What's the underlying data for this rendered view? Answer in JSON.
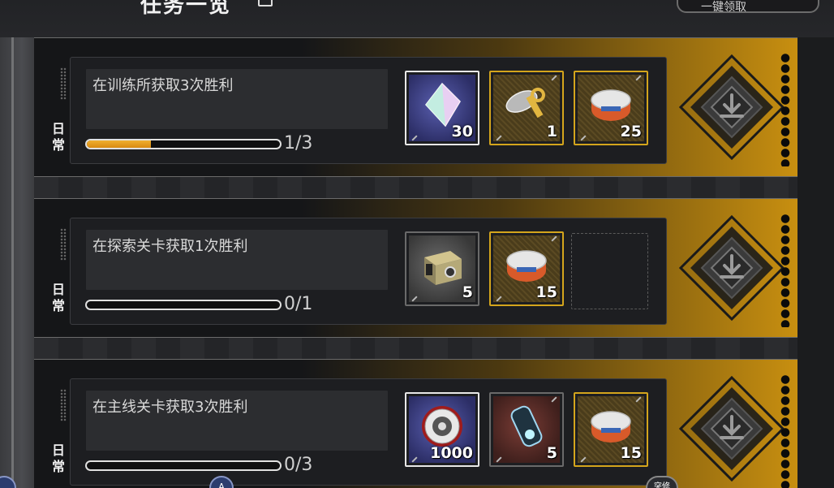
{
  "header": {
    "title": "任务一览",
    "right_button_label": "一键领取"
  },
  "tasks": [
    {
      "category": "日常",
      "description": "在训练所获取3次胜利",
      "progress_text": "1/3",
      "progress_fraction": 0.333,
      "rewards": [
        {
          "icon": "crystal-shard-icon",
          "count": "30",
          "frame": "silver",
          "bg": "purple"
        },
        {
          "icon": "key-and-tag-icon",
          "count": "1",
          "frame": "gold",
          "bg": "gold"
        },
        {
          "icon": "cat-food-can-icon",
          "count": "25",
          "frame": "gold",
          "bg": "gold"
        }
      ]
    },
    {
      "category": "日常",
      "description": "在探索关卡获取1次胜利",
      "progress_text": "0/1",
      "progress_fraction": 0.0,
      "rewards": [
        {
          "icon": "supply-box-icon",
          "count": "5",
          "frame": "grey",
          "bg": "greybg"
        },
        {
          "icon": "cat-food-can-icon",
          "count": "15",
          "frame": "gold",
          "bg": "gold"
        },
        {
          "icon": "empty-slot",
          "count": "",
          "frame": "empty",
          "bg": ""
        }
      ]
    },
    {
      "category": "日常",
      "description": "在主线关卡获取3次胜利",
      "progress_text": "0/3",
      "progress_fraction": 0.0,
      "rewards": [
        {
          "icon": "gear-disc-icon",
          "count": "1000",
          "frame": "silver",
          "bg": "purple"
        },
        {
          "icon": "energy-capsule-icon",
          "count": "5",
          "frame": "grey",
          "bg": "red"
        },
        {
          "icon": "cat-food-can-icon",
          "count": "15",
          "frame": "gold",
          "bg": "gold"
        }
      ]
    }
  ],
  "colors": {
    "accent_gold": "#c88f10",
    "progress_fill": "#e39b1a",
    "reward_gold_frame": "#d4a51c"
  },
  "bottom_badges": [
    "A",
    "突修"
  ]
}
